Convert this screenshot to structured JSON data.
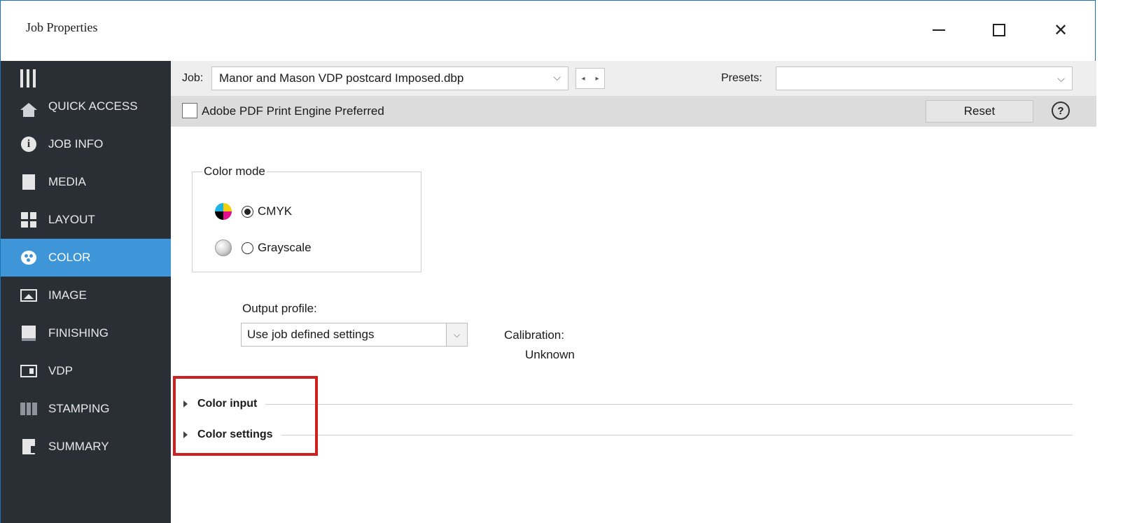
{
  "window": {
    "title": "Job Properties",
    "controls": {
      "minimize": "–",
      "maximize": "☐",
      "close": "✕"
    }
  },
  "sidebar": {
    "items": [
      {
        "label": "QUICK ACCESS",
        "icon": "home-icon"
      },
      {
        "label": "JOB INFO",
        "icon": "info-icon"
      },
      {
        "label": "MEDIA",
        "icon": "document-icon"
      },
      {
        "label": "LAYOUT",
        "icon": "layout-icon"
      },
      {
        "label": "COLOR",
        "icon": "palette-icon",
        "active": true
      },
      {
        "label": "IMAGE",
        "icon": "image-icon"
      },
      {
        "label": "FINISHING",
        "icon": "finishing-icon"
      },
      {
        "label": "VDP",
        "icon": "vdp-icon"
      },
      {
        "label": "STAMPING",
        "icon": "stamping-icon"
      },
      {
        "label": "SUMMARY",
        "icon": "summary-icon"
      }
    ],
    "active_color": "#3e95d8"
  },
  "jobbar": {
    "job_label": "Job:",
    "job_value": "Manor and Mason VDP postcard Imposed.dbp",
    "presets_label": "Presets:",
    "presets_value": ""
  },
  "pdfbar": {
    "checkbox_label": "Adobe PDF Print Engine Preferred",
    "checked": false,
    "reset_label": "Reset",
    "help_glyph": "?"
  },
  "color_mode": {
    "title": "Color mode",
    "options": [
      {
        "label": "CMYK",
        "selected": true
      },
      {
        "label": "Grayscale",
        "selected": false
      }
    ]
  },
  "output": {
    "label": "Output profile:",
    "value": "Use job defined settings",
    "calibration_label": "Calibration:",
    "calibration_value": "Unknown"
  },
  "sections": [
    {
      "label": "Color input",
      "expanded": false
    },
    {
      "label": "Color settings",
      "expanded": false
    }
  ],
  "highlight_color": "#d01f1f"
}
